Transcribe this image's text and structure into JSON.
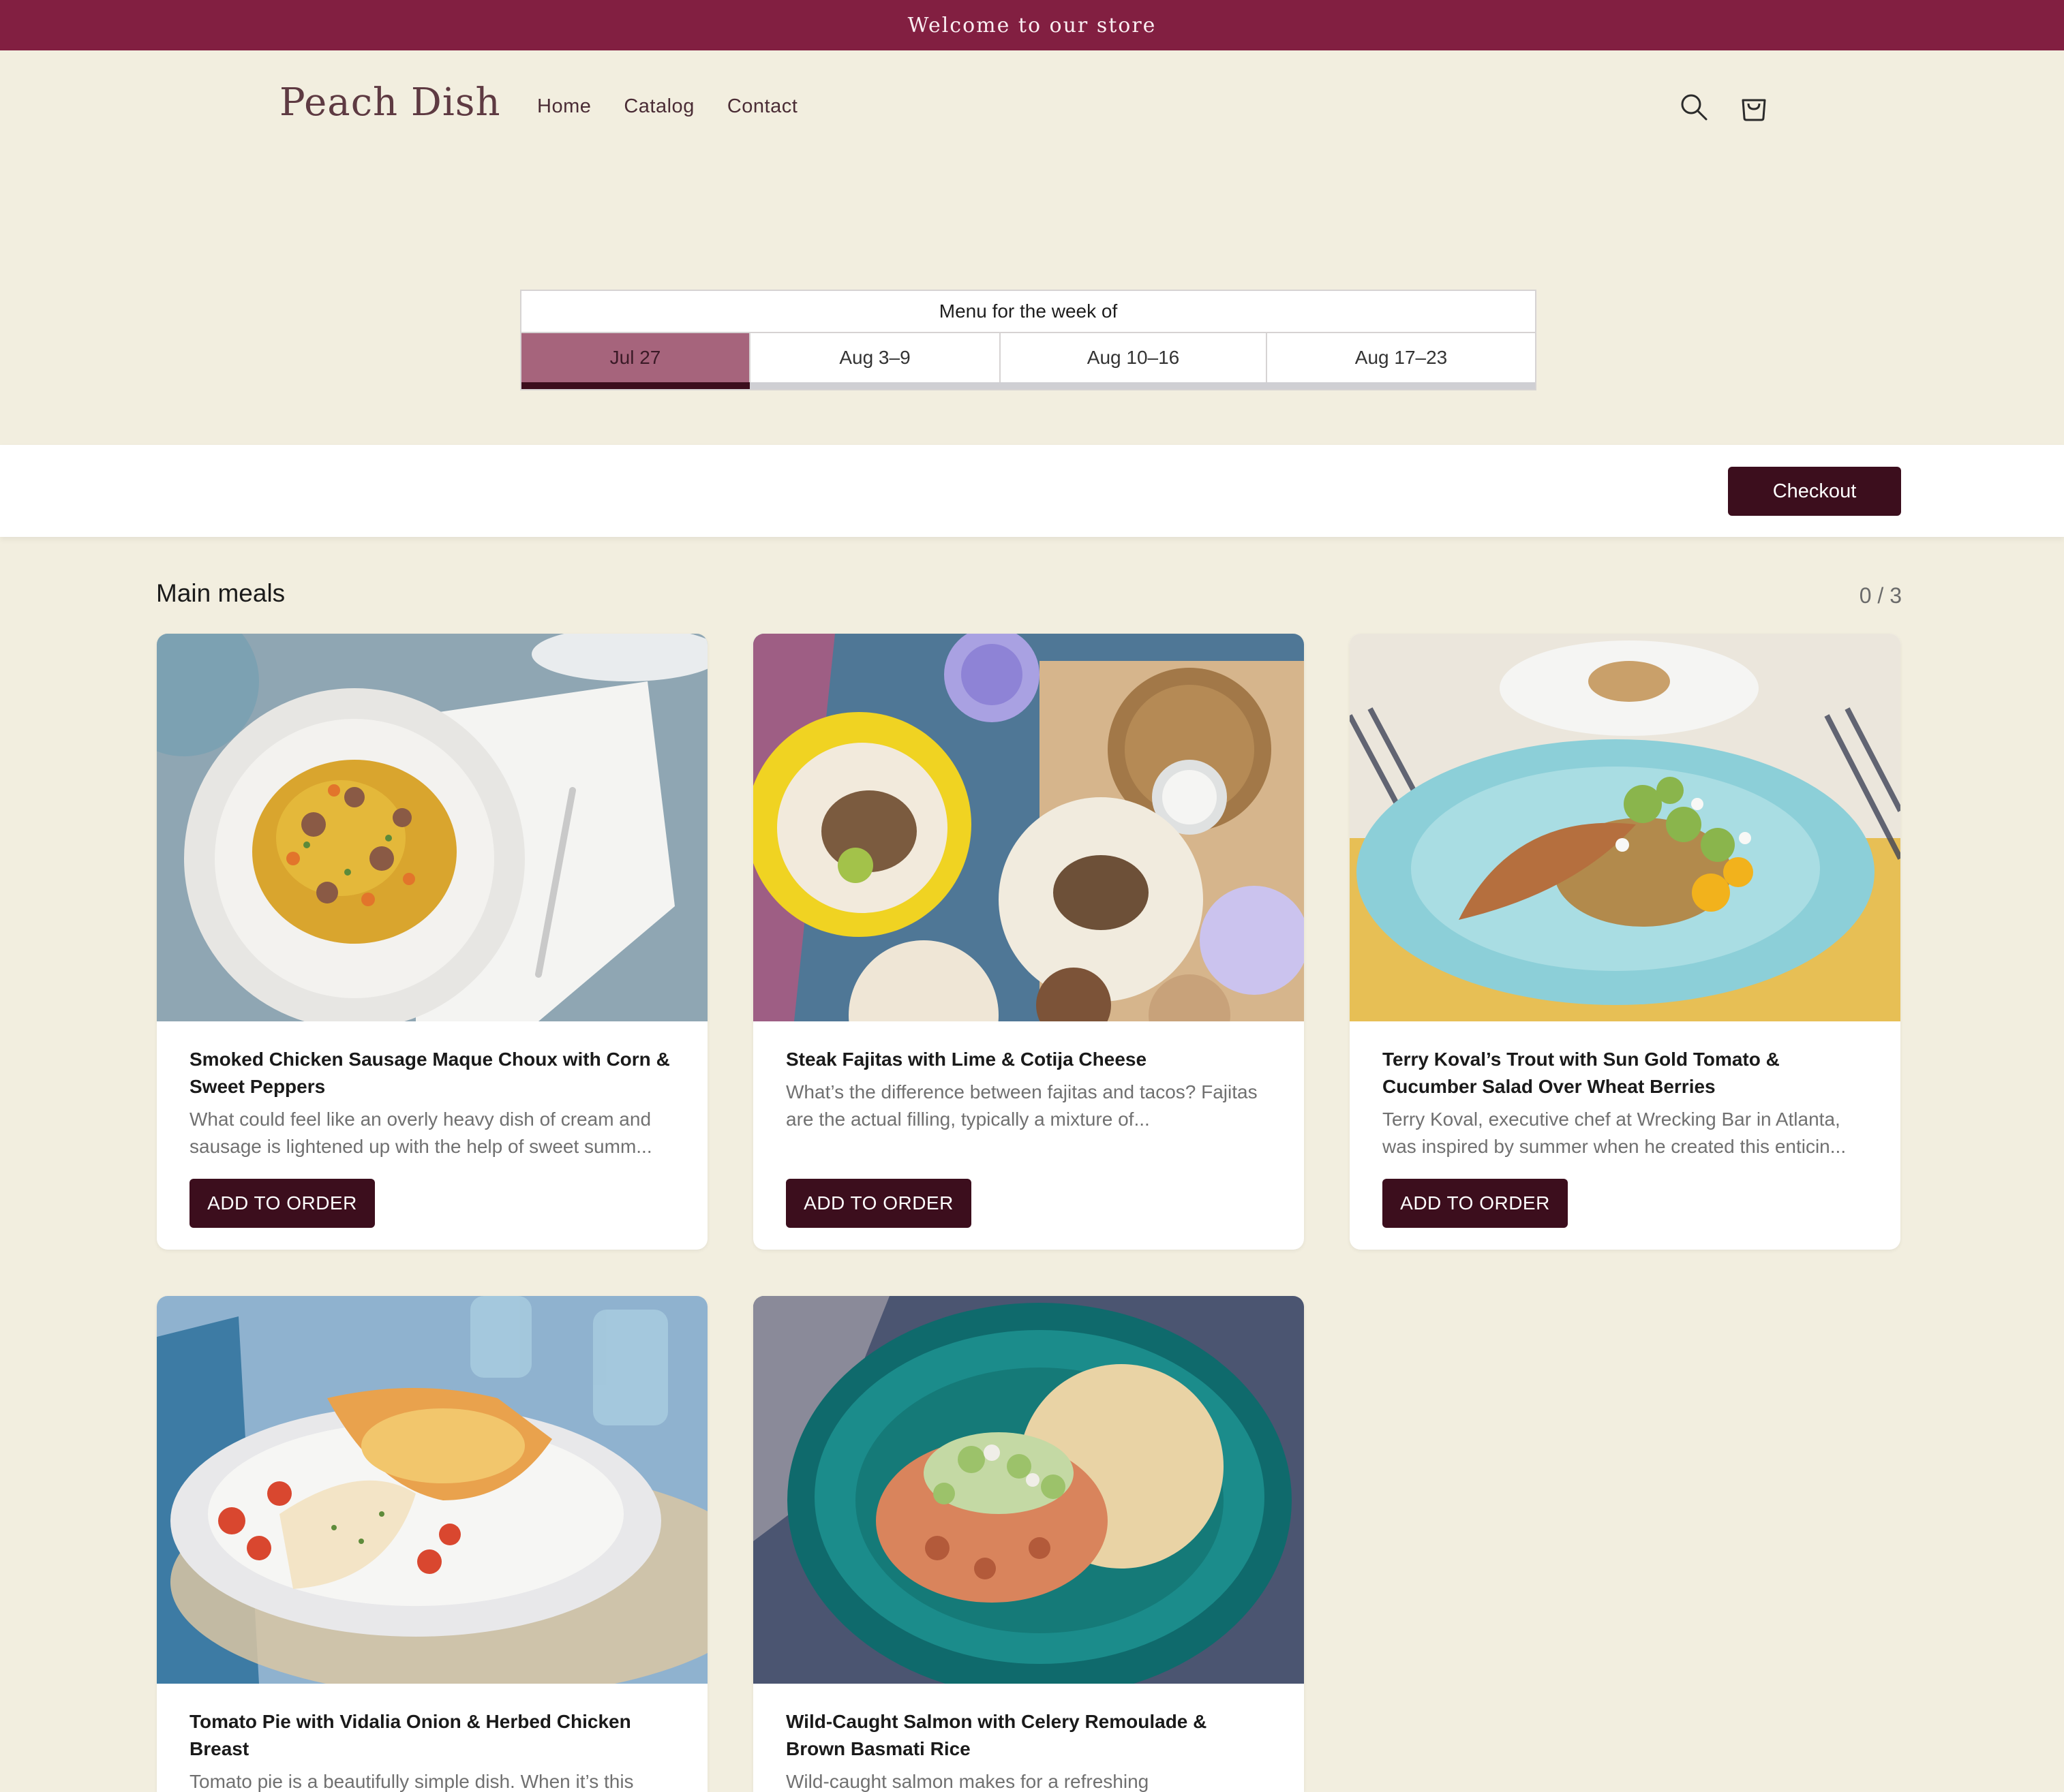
{
  "announcement": "Welcome to our store",
  "header": {
    "brand": "Peach Dish",
    "nav": [
      "Home",
      "Catalog",
      "Contact"
    ],
    "icons": [
      "search-icon",
      "cart-icon"
    ]
  },
  "week_selector": {
    "title": "Menu for the week of",
    "tabs": [
      "Jul 27",
      "Aug 3–9",
      "Aug 10–16",
      "Aug 17–23"
    ],
    "active_index": 0,
    "progress_fraction": 0.225
  },
  "checkout": {
    "label": "Checkout"
  },
  "section": {
    "title": "Main meals",
    "count": "0 / 3"
  },
  "meals": [
    {
      "title": "Smoked Chicken Sausage Maque Choux with Corn & Sweet Peppers",
      "description": "What could feel like an overly heavy dish of cream and sausage is lightened up with the help of sweet summ...",
      "button": "ADD TO ORDER"
    },
    {
      "title": "Steak Fajitas with Lime & Cotija Cheese",
      "description": "What’s the difference between fajitas and tacos? Fajitas are the actual filling, typically a mixture of...",
      "button": "ADD TO ORDER"
    },
    {
      "title": "Terry Koval’s Trout with Sun Gold Tomato & Cucumber Salad Over Wheat Berries",
      "description": "Terry Koval, executive chef at Wrecking Bar in Atlanta, was inspired by summer when he created this enticin...",
      "button": "ADD TO ORDER"
    },
    {
      "title": "Tomato Pie with Vidalia Onion & Herbed Chicken Breast",
      "description": "Tomato pie is a beautifully simple dish. When it’s this"
    },
    {
      "title": "Wild-Caught Salmon with Celery Remoulade & Brown Basmati Rice",
      "description": "Wild-caught salmon makes for a refreshing"
    }
  ],
  "colors": {
    "accent": "#821f41",
    "button": "#3c0e1d",
    "active_tab": "#a6647c",
    "background": "#f2eedf"
  }
}
